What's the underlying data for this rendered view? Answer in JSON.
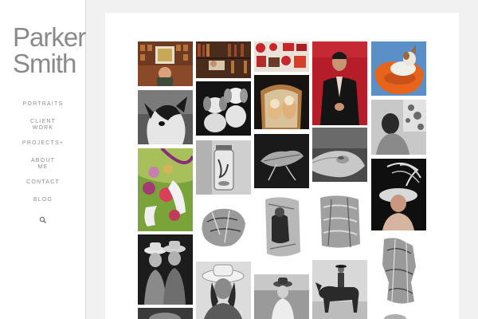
{
  "site": {
    "logo_line1": "Parker",
    "logo_line2": "Smith"
  },
  "nav": {
    "portraits": "PORTRAITS",
    "client_work_1": "CLIENT",
    "client_work_2": "WORK",
    "projects": "PROJECTS",
    "projects_marker": "+",
    "about_1": "ABOUT",
    "about_2": "ME",
    "contact": "CONTACT",
    "blog": "BLOG"
  },
  "icons": {
    "search": "search-icon"
  },
  "colors": {
    "sidebar_bg": "#ffffff",
    "page_bg": "#f1f1f1",
    "nav_text": "#8d8d8d",
    "logo_text": "#8a8a8a"
  },
  "gallery": {
    "photos": [
      "man-with-framed-art",
      "man-reading-in-library",
      "cola-signs-collage",
      "man-in-suit-red-backdrop",
      "dog-on-orange-chair",
      "dog-close-up",
      "two-dogs-bw",
      "two-dogs-on-armchair",
      "hand-holding-object",
      "woman-by-window-bw",
      "flowers-in-hands",
      "jar-bw",
      "dried-leaf-bw",
      "woman-with-feather-hat",
      "crushed-can-1",
      "crushed-can-2",
      "crushed-can-3",
      "two-girls-cowboy-hats",
      "crushed-can-4",
      "woman-in-cowboy-hat",
      "boy-in-hat",
      "rider-on-horse",
      "partial-bottom-1",
      "partial-bottom-2"
    ]
  }
}
